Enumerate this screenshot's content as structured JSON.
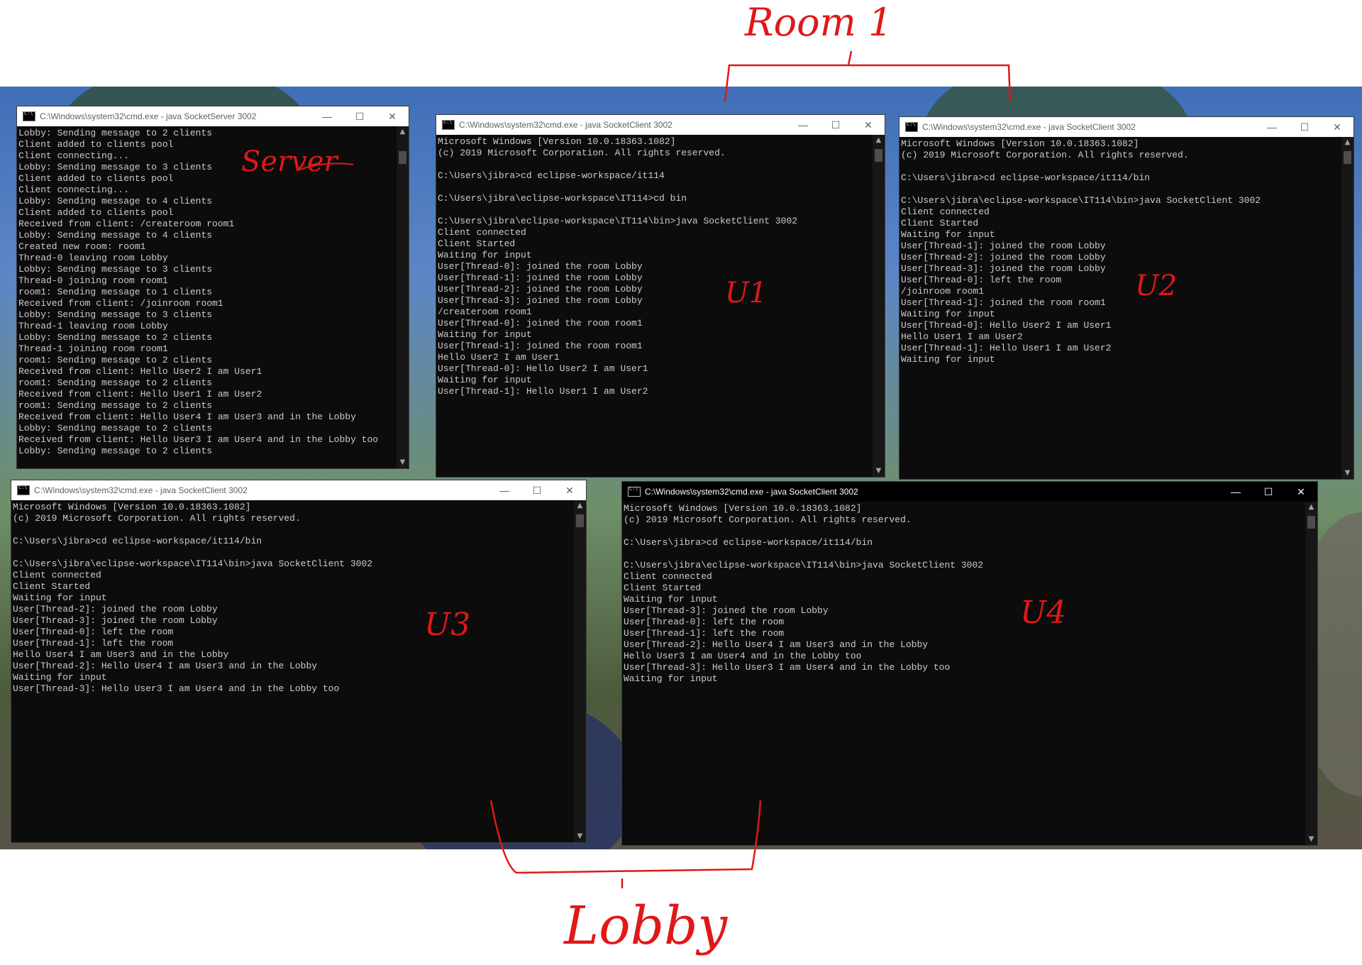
{
  "windows": {
    "server": {
      "title": "C:\\Windows\\system32\\cmd.exe - java  SocketServer 3002",
      "lines": [
        "Lobby: Sending message to 2 clients",
        "Client added to clients pool",
        "Client connecting...",
        "Lobby: Sending message to 3 clients",
        "Client added to clients pool",
        "Client connecting...",
        "Lobby: Sending message to 4 clients",
        "Client added to clients pool",
        "Received from client: /createroom room1",
        "Lobby: Sending message to 4 clients",
        "Created new room: room1",
        "Thread-0 leaving room Lobby",
        "Lobby: Sending message to 3 clients",
        "Thread-0 joining room room1",
        "room1: Sending message to 1 clients",
        "Received from client: /joinroom room1",
        "Lobby: Sending message to 3 clients",
        "Thread-1 leaving room Lobby",
        "Lobby: Sending message to 2 clients",
        "Thread-1 joining room room1",
        "room1: Sending message to 2 clients",
        "Received from client: Hello User2 I am User1",
        "room1: Sending message to 2 clients",
        "Received from client: Hello User1 I am User2",
        "room1: Sending message to 2 clients",
        "Received from client: Hello User4 I am User3 and in the Lobby",
        "Lobby: Sending message to 2 clients",
        "Received from client: Hello User3 I am User4 and in the Lobby too",
        "Lobby: Sending message to 2 clients"
      ]
    },
    "u1": {
      "title": "C:\\Windows\\system32\\cmd.exe - java  SocketClient 3002",
      "lines": [
        "Microsoft Windows [Version 10.0.18363.1082]",
        "(c) 2019 Microsoft Corporation. All rights reserved.",
        "",
        "C:\\Users\\jibra>cd eclipse-workspace/it114",
        "",
        "C:\\Users\\jibra\\eclipse-workspace\\IT114>cd bin",
        "",
        "C:\\Users\\jibra\\eclipse-workspace\\IT114\\bin>java SocketClient 3002",
        "Client connected",
        "Client Started",
        "Waiting for input",
        "User[Thread-0]: joined the room Lobby",
        "User[Thread-1]: joined the room Lobby",
        "User[Thread-2]: joined the room Lobby",
        "User[Thread-3]: joined the room Lobby",
        "/createroom room1",
        "User[Thread-0]: joined the room room1",
        "Waiting for input",
        "User[Thread-1]: joined the room room1",
        "Hello User2 I am User1",
        "User[Thread-0]: Hello User2 I am User1",
        "Waiting for input",
        "User[Thread-1]: Hello User1 I am User2"
      ]
    },
    "u2": {
      "title": "C:\\Windows\\system32\\cmd.exe - java  SocketClient 3002",
      "lines": [
        "Microsoft Windows [Version 10.0.18363.1082]",
        "(c) 2019 Microsoft Corporation. All rights reserved.",
        "",
        "C:\\Users\\jibra>cd eclipse-workspace/it114/bin",
        "",
        "C:\\Users\\jibra\\eclipse-workspace\\IT114\\bin>java SocketClient 3002",
        "Client connected",
        "Client Started",
        "Waiting for input",
        "User[Thread-1]: joined the room Lobby",
        "User[Thread-2]: joined the room Lobby",
        "User[Thread-3]: joined the room Lobby",
        "User[Thread-0]: left the room",
        "/joinroom room1",
        "User[Thread-1]: joined the room room1",
        "Waiting for input",
        "User[Thread-0]: Hello User2 I am User1",
        "Hello User1 I am User2",
        "User[Thread-1]: Hello User1 I am User2",
        "Waiting for input"
      ]
    },
    "u3": {
      "title": "C:\\Windows\\system32\\cmd.exe - java  SocketClient 3002",
      "lines": [
        "Microsoft Windows [Version 10.0.18363.1082]",
        "(c) 2019 Microsoft Corporation. All rights reserved.",
        "",
        "C:\\Users\\jibra>cd eclipse-workspace/it114/bin",
        "",
        "C:\\Users\\jibra\\eclipse-workspace\\IT114\\bin>java SocketClient 3002",
        "Client connected",
        "Client Started",
        "Waiting for input",
        "User[Thread-2]: joined the room Lobby",
        "User[Thread-3]: joined the room Lobby",
        "User[Thread-0]: left the room",
        "User[Thread-1]: left the room",
        "Hello User4 I am User3 and in the Lobby",
        "User[Thread-2]: Hello User4 I am User3 and in the Lobby",
        "Waiting for input",
        "User[Thread-3]: Hello User3 I am User4 and in the Lobby too"
      ]
    },
    "u4": {
      "title": "C:\\Windows\\system32\\cmd.exe - java  SocketClient 3002",
      "lines": [
        "Microsoft Windows [Version 10.0.18363.1082]",
        "(c) 2019 Microsoft Corporation. All rights reserved.",
        "",
        "C:\\Users\\jibra>cd eclipse-workspace/it114/bin",
        "",
        "C:\\Users\\jibra\\eclipse-workspace\\IT114\\bin>java SocketClient 3002",
        "Client connected",
        "Client Started",
        "Waiting for input",
        "User[Thread-3]: joined the room Lobby",
        "User[Thread-0]: left the room",
        "User[Thread-1]: left the room",
        "User[Thread-2]: Hello User4 I am User3 and in the Lobby",
        "Hello User3 I am User4 and in the Lobby too",
        "User[Thread-3]: Hello User3 I am User4 and in the Lobby too",
        "Waiting for input"
      ]
    }
  },
  "controls": {
    "minimize": "—",
    "maximize": "☐",
    "close": "✕",
    "scroll_up": "▲",
    "scroll_down": "▼"
  },
  "annotations": {
    "room1": "Room 1",
    "server": "Server",
    "u1": "U1",
    "u2": "U2",
    "u3": "U3",
    "u4": "U4",
    "lobby": "Lobby"
  },
  "colors": {
    "annotation": "#e01818",
    "terminal_bg": "#0c0c0c",
    "terminal_text": "#cccccc"
  }
}
